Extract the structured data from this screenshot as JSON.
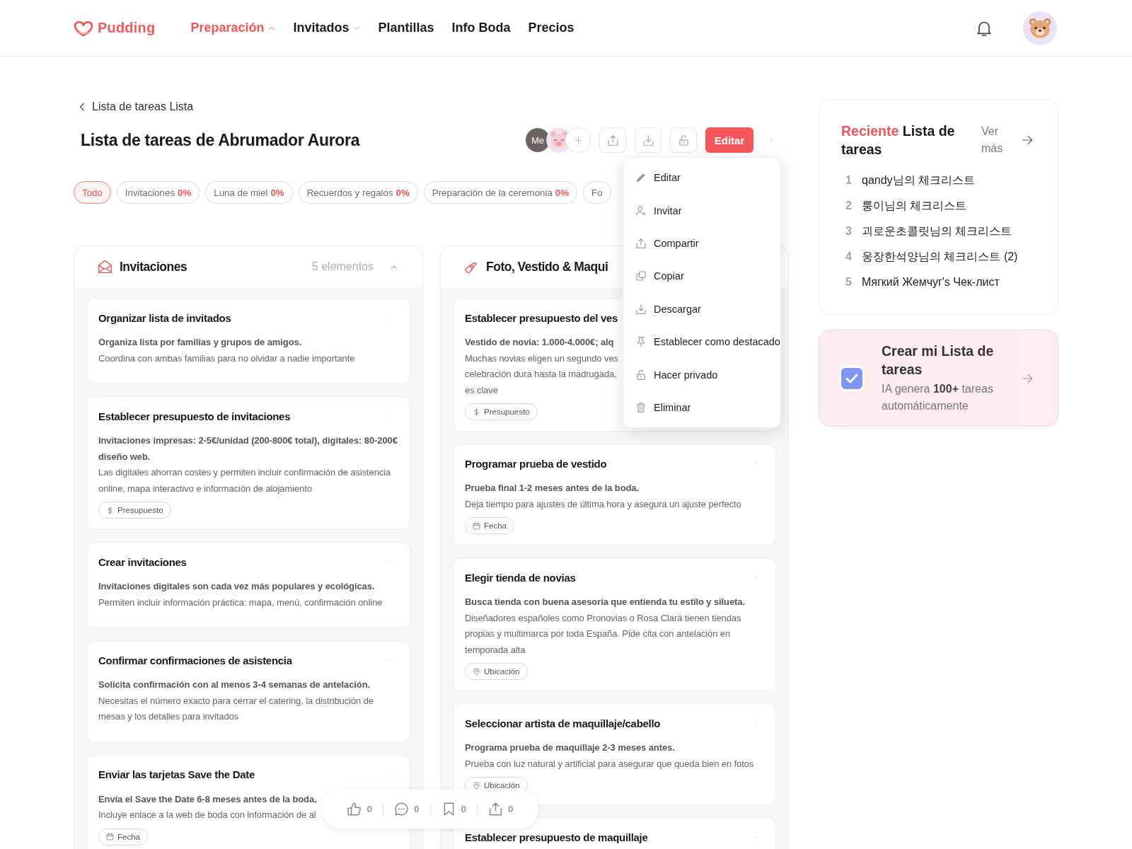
{
  "header": {
    "brand": "Pudding",
    "nav": [
      {
        "label": "Preparación",
        "selected": true,
        "expanded": true
      },
      {
        "label": "Invitados",
        "selected": false,
        "expanded": false
      },
      {
        "label": "Plantillas",
        "selected": false
      },
      {
        "label": "Info Boda",
        "selected": false
      },
      {
        "label": "Precios",
        "selected": false
      }
    ]
  },
  "page": {
    "back_link": "Lista de tareas Lista",
    "title": "Lista de tareas de Abrumador Aurora"
  },
  "toolbar": {
    "members": [
      {
        "kind": "me",
        "label": "Me"
      },
      {
        "kind": "pig"
      }
    ],
    "actions": [
      {
        "kind": "share"
      },
      {
        "kind": "download"
      },
      {
        "kind": "lock"
      }
    ],
    "edit_button": "Editar"
  },
  "menu": [
    {
      "kind": "edit",
      "label": "Editar"
    },
    {
      "kind": "invite",
      "label": "Invitar"
    },
    {
      "kind": "share",
      "label": "Compartir"
    },
    {
      "kind": "copy",
      "label": "Copiar"
    },
    {
      "kind": "download",
      "label": "Descargar"
    },
    {
      "kind": "pin",
      "label": "Establecer como destacado"
    },
    {
      "kind": "private",
      "label": "Hacer privado"
    },
    {
      "kind": "delete",
      "label": "Eliminar"
    }
  ],
  "chips": [
    {
      "label": "Todo",
      "selected": true
    },
    {
      "label": "Invitaciones",
      "percent": "0%",
      "selected": false
    },
    {
      "label": "Luna de miel",
      "percent": "0%",
      "selected": false
    },
    {
      "label": "Recuerdos y regalos",
      "percent": "0%",
      "selected": false
    },
    {
      "label": "Preparación de la ceremonia",
      "percent": "0%",
      "selected": false
    },
    {
      "label": "Fo",
      "selected": false
    }
  ],
  "columns": [
    {
      "title": "Invitaciones",
      "count": "5 elementos",
      "expanded": true,
      "tasks": [
        {
          "title": "Organizar lista de invitados",
          "expanded": true,
          "summary": "Organiza lista por familias y grupos de amigos.",
          "detail": "Coordina con ambas familias para no olvidar a nadie importante"
        },
        {
          "title": "Establecer presupuesto de invitaciones",
          "expanded": true,
          "summary": "Invitaciones impresas: 2-5€/unidad (200-800€ total), digitales: 80-200€ diseño web.",
          "detail": "Las digitales ahorran costes y permiten incluir confirmación de asistencia online, mapa interactivo e información de alojamiento",
          "tag": {
            "kind": "budget",
            "label": "Presupuesto"
          }
        },
        {
          "title": "Crear invitaciones",
          "expanded": true,
          "summary": "Invitaciones digitales son cada vez más populares y ecológicas.",
          "detail": "Permiten incluir información práctica: mapa, menú, confirmación online"
        },
        {
          "title": "Confirmar confirmaciones de asistencia",
          "expanded": true,
          "summary": "Solicita confirmación con al menos 3-4 semanas de antelación.",
          "detail": "Necesitas el número exacto para cerrar el catering, la distribución de mesas y los detalles para invitados"
        },
        {
          "title": "Enviar las tarjetas Save the Date",
          "expanded": true,
          "summary": "Envía el Save the Date 6-8 meses antes de la boda.",
          "detail_lines": [
            "Incluye enlace a la web de boda con información de al"
          ],
          "tag": {
            "kind": "date",
            "label": "Fecha"
          }
        }
      ]
    },
    {
      "title": "Foto, Vestido & Maqui",
      "tasks": [
        {
          "title": "Establecer presupuesto del ves",
          "summary": "Vestido de novia: 1.000-4.000€; alq",
          "detail_lines": [
            "Muchas novias eligen un segundo ves",
            "celebración dura hasta la madrugada,",
            "es clave"
          ],
          "tag": {
            "kind": "budget",
            "label": "Presupuesto"
          }
        },
        {
          "title": "Programar prueba de vestido",
          "expanded": true,
          "summary": "Prueba final 1-2 meses antes de la boda.",
          "detail": "Deja tiempo para ajustes de última hora y asegura un ajuste perfecto",
          "tag": {
            "kind": "date",
            "label": "Fecha"
          }
        },
        {
          "title": "Elegir tienda de novias",
          "expanded": true,
          "summary": "Busca tienda con buena asesoría que entienda tu estilo y silueta.",
          "detail": "Diseñadores españoles como Pronovias o Rosa Clará tienen tiendas propias y multimarca por toda España. Pide cita con antelación en temporada alta",
          "tag": {
            "kind": "location",
            "label": "Ubicación"
          }
        },
        {
          "title": "Seleccionar artista de maquillaje/cabello",
          "expanded": true,
          "summary": "Programa prueba de maquillaje 2-3 meses antes.",
          "detail": "Prueba con luz natural y artificial para asegurar que queda bien en fotos",
          "tag": {
            "kind": "location",
            "label": "Ubicación"
          }
        },
        {
          "title": "Establecer presupuesto de maquillaje",
          "expanded": true
        }
      ]
    }
  ],
  "sidebar": {
    "recent": {
      "title_accent": "Reciente",
      "title": "Lista de tareas",
      "more": "Ver más",
      "items": [
        {
          "number": "1",
          "label": "qandy님의 체크리스트"
        },
        {
          "number": "2",
          "label": "룽이님의 체크리스트"
        },
        {
          "number": "3",
          "label": "괴로운초콜릿님의 체크리스트"
        },
        {
          "number": "4",
          "label": "웅장한석양님의 체크리스트 (2)"
        },
        {
          "number": "5",
          "label": "Мягкий Жемчуг's Чек-лист"
        }
      ]
    },
    "promo": {
      "title": "Crear mi Lista de tareas",
      "text": "IA genera **100+** tareas automáticamente"
    }
  },
  "reactions": [
    {
      "kind": "like",
      "count": "0"
    },
    {
      "kind": "comment",
      "count": "0"
    },
    {
      "kind": "bookmark",
      "count": "0"
    },
    {
      "kind": "share",
      "count": "0"
    }
  ]
}
